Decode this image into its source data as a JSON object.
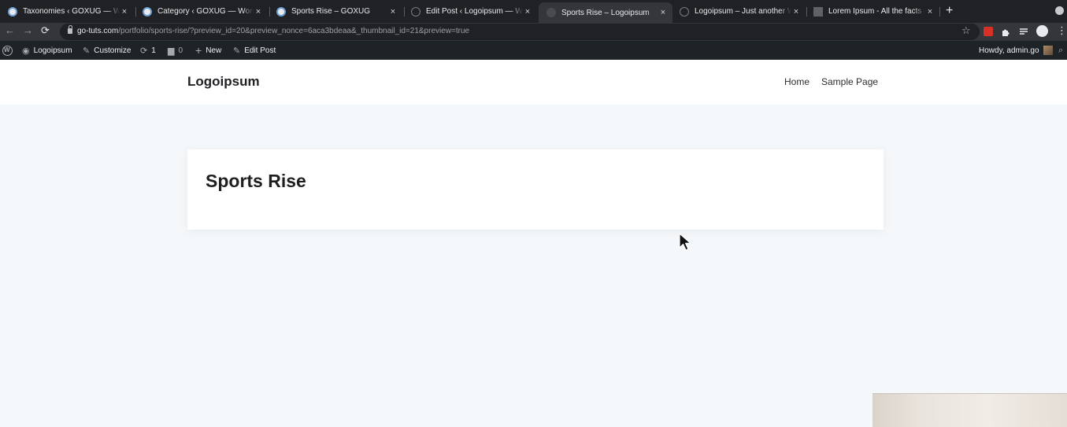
{
  "browser": {
    "tabs": [
      {
        "title": "Taxonomies ‹ GOXUG — WordPress",
        "icon": "wordpress-icon",
        "active": false
      },
      {
        "title": "Category ‹ GOXUG — WordPress",
        "icon": "wordpress-icon",
        "active": false
      },
      {
        "title": "Sports Rise – GOXUG",
        "icon": "wordpress-icon",
        "active": false
      },
      {
        "title": "Edit Post ‹ Logoipsum — WordPress",
        "icon": "globe-icon",
        "active": false
      },
      {
        "title": "Sports Rise – Logoipsum",
        "icon": "globe-icon",
        "active": true
      },
      {
        "title": "Logoipsum – Just another WordPress site",
        "icon": "globe-icon",
        "active": false
      },
      {
        "title": "Lorem Ipsum - All the facts - Lipsum",
        "icon": "page-icon",
        "active": false
      }
    ],
    "close_glyph": "×",
    "new_tab_glyph": "+",
    "url_host": "go-tuts.com",
    "url_path": "/portfolio/sports-rise/?preview_id=20&preview_nonce=6aca3bdeaa&_thumbnail_id=21&preview=true",
    "back_glyph": "←",
    "forward_glyph": "→",
    "reload_glyph": "⟳",
    "star_glyph": "☆",
    "menu_glyph": "⋮",
    "accent_color": "#35363a"
  },
  "adminbar": {
    "site_name": "Logoipsum",
    "customize": "Customize",
    "updates_count": "1",
    "comments_count": "0",
    "new_label": "New",
    "edit_post": "Edit Post",
    "howdy": "Howdy, admin.go"
  },
  "site": {
    "title": "Logoipsum",
    "menu": [
      "Home",
      "Sample Page"
    ]
  },
  "post": {
    "title": "Sports Rise"
  }
}
